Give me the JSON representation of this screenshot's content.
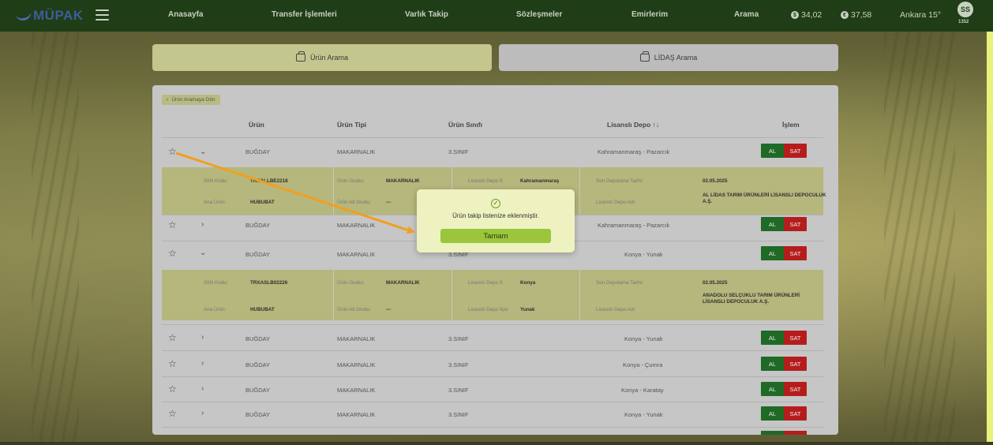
{
  "nav": {
    "logo": "MÜPAK",
    "items": [
      "Anasayfa",
      "Transfer İşlemleri",
      "Varlık Takip",
      "Sözleşmeler",
      "Emirlerim",
      "Arama"
    ],
    "rates": [
      {
        "icon": "dollar-icon",
        "glyph": "$",
        "value": "34,02"
      },
      {
        "icon": "euro-icon",
        "glyph": "€",
        "value": "37,58"
      }
    ],
    "weather": "Ankara 15°",
    "avatar": "SS",
    "avatar_sub": "1352"
  },
  "tabs": {
    "urun": "Ürün Arama",
    "lidas": "LİDAŞ Arama"
  },
  "back_label": "Ürün Aramaya Dön",
  "table": {
    "headers": {
      "urun": "Ürün",
      "tip": "Ürün Tipi",
      "sinif": "Ürün Sınıfı",
      "depo": "Lisanslı Depo ↑↓",
      "islem": "İşlem"
    },
    "buy_label": "AL",
    "sell_label": "SAT",
    "rows": [
      {
        "urun": "BUĞDAY",
        "tip": "MAKARNALIK",
        "sinif": "3.SINIF",
        "depo": "Kahramanmaraş - Pazarcık"
      },
      {
        "urun": "BUĞDAY",
        "tip": "MAKARNALIK",
        "sinif": "",
        "depo": "Kahramanmaraş - Pazarcık"
      },
      {
        "urun": "BUĞDAY",
        "tip": "MAKARNALIK",
        "sinif": "3.SINIF",
        "depo": "Konya - Yunak"
      },
      {
        "urun": "BUĞDAY",
        "tip": "MAKARNALIK",
        "sinif": "3.SINIF",
        "depo": "Konya - Yunak"
      },
      {
        "urun": "BUĞDAY",
        "tip": "MAKARNALIK",
        "sinif": "3.SINIF",
        "depo": "Konya - Çumra"
      },
      {
        "urun": "BUĞDAY",
        "tip": "MAKARNALIK",
        "sinif": "3.SINIF",
        "depo": "Konya - Karatay"
      },
      {
        "urun": "BUĞDAY",
        "tip": "MAKARNALIK",
        "sinif": "3.SINIF",
        "depo": "Konya - Yunak"
      }
    ],
    "details": [
      {
        "isin_label": "ISIN Kodu:",
        "isin": "TRXALLBE2218",
        "ana_label": "Ana Ürün:",
        "ana": "HUBUBAT",
        "grup_label": "Ürün Grubu:",
        "grup": "MAKARNALIK",
        "alt_label": "Ürün Alt Grubu:",
        "alt": "---",
        "il_label": "Lisanslı Depo İl:",
        "il": "Kahramanmaraş",
        "ilce_label": "",
        "ilce": "",
        "tarih_label": "Son Depolama Tarihi:",
        "tarih": "02.05.2025",
        "ad_label": "Lisanslı Depo Adı:",
        "ad": "AL LİDAS TARIM ÜRÜNLERİ LİSANSLI DEPOCULUK A.Ş."
      },
      {
        "isin_label": "ISIN Kodu:",
        "isin": "TRXASLB02226",
        "ana_label": "Ana Ürün:",
        "ana": "HUBUBAT",
        "grup_label": "Ürün Grubu:",
        "grup": "MAKARNALIK",
        "alt_label": "Ürün Alt Grubu:",
        "alt": "---",
        "il_label": "Lisanslı Depo İl:",
        "il": "Konya",
        "ilce_label": "Lisanslı Depo İlçe:",
        "ilce": "Yunak",
        "tarih_label": "Son Depolama Tarihi:",
        "tarih": "02.05.2025",
        "ad_label": "Lisanslı Depo Adı:",
        "ad": "ANADOLU SELÇUKLU TARIM ÜRÜNLERİ LİSANSLI DEPOCULUK A.Ş."
      }
    ]
  },
  "modal": {
    "message": "Ürün takip listenize eklenmiştir.",
    "ok": "Tamam"
  },
  "colors": {
    "nav_bg": "#1f3d17",
    "buy": "#1f6a26",
    "sell": "#b51d1d",
    "ok_button": "#9bc63b",
    "arrow": "#f0a020"
  }
}
